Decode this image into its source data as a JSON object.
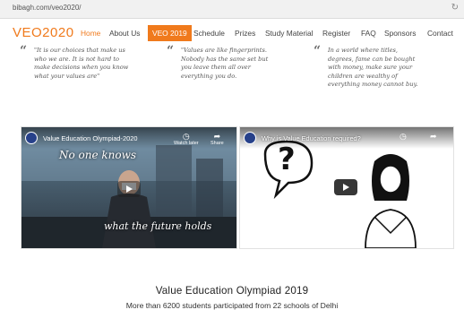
{
  "browser": {
    "url": "bibagh.com/veo2020/"
  },
  "nav": {
    "brand": "VEO2020",
    "items": [
      {
        "label": "Home"
      },
      {
        "label": "About Us"
      },
      {
        "label": "VEO 2019"
      },
      {
        "label": "Schedule"
      },
      {
        "label": "Prizes"
      },
      {
        "label": "Study Material"
      },
      {
        "label": "Register"
      },
      {
        "label": "FAQ"
      },
      {
        "label": "Sponsors"
      },
      {
        "label": "Contact"
      }
    ],
    "active_item": "VEO 2019"
  },
  "quotes": [
    {
      "l1": "\"It is our choices that make us",
      "l2": "who we are. It is not hard to",
      "l3": "make decisions when you know",
      "l4": "what your values are\""
    },
    {
      "l1": "\"Values are like fingerprints.",
      "l2": "Nobody has the same set but",
      "l3": "you leave them all over",
      "l4": "everything you do."
    },
    {
      "l1": "In a world where titles,",
      "l2": "degrees, fame can be bought",
      "l3": "with money, make sure your",
      "l4": "children are wealthy of",
      "l5": "everything money cannot buy."
    }
  ],
  "videos": [
    {
      "title": "Value Education Olympiad-2020",
      "watch_later": "Watch later",
      "share": "Share",
      "overlay_top": "No one knows",
      "overlay_bottom": "what the future holds"
    },
    {
      "title": "Why is Value Education required?",
      "overlay_symbol": "?"
    }
  ],
  "main": {
    "title": "Value Education Olympiad 2019",
    "subtitle": "More than 6200 students participated from 22 schools of Delhi"
  },
  "colors": {
    "accent": "#f07a1c"
  }
}
